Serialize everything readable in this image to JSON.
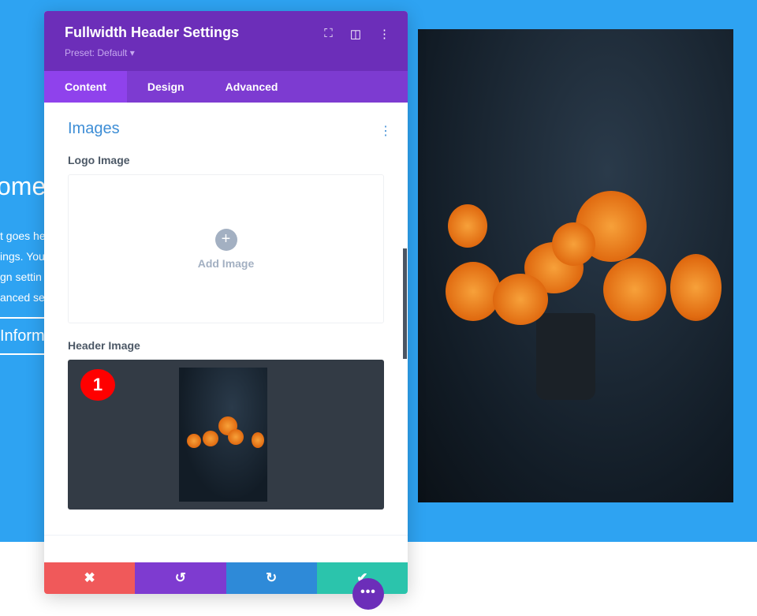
{
  "background": {
    "title": "ome",
    "text": "t goes he\nings. You\ngn settin\nanced se",
    "button": "Inform"
  },
  "panel": {
    "title": "Fullwidth Header Settings",
    "preset": "Preset: Default ▾",
    "icons": [
      "focus-icon",
      "sidebar-layout-icon",
      "more-vertical-icon"
    ],
    "tabs": [
      {
        "label": "Content"
      },
      {
        "label": "Design"
      },
      {
        "label": "Advanced"
      }
    ],
    "section": "Images",
    "logo_label": "Logo Image",
    "add_image": "Add Image",
    "header_label": "Header Image",
    "badge": "1"
  },
  "footer": {
    "cancel": "✖",
    "undo": "↺",
    "redo": "↻",
    "save": "✔"
  },
  "fab": "•••",
  "colors": {
    "hero": "#2ea3f2",
    "header": "#6c2eb9",
    "tabs": "#7d3bd1",
    "cancel": "#f0595a",
    "undo": "#7e3bd0",
    "redo": "#2e8ad8",
    "save": "#2bc4ac"
  }
}
